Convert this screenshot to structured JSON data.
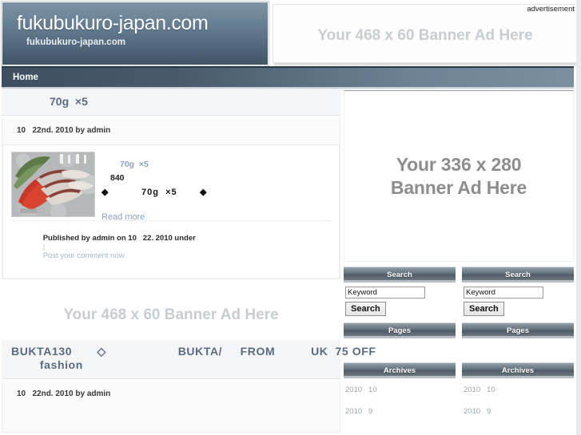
{
  "site": {
    "title": "fukubukuro-japan.com",
    "tagline": "fukubukuro-japan.com"
  },
  "nav": {
    "items": [
      {
        "label": "Home"
      }
    ]
  },
  "ads": {
    "label": "advertisement",
    "top_banner_text": "Your 468 x 60 Banner Ad Here",
    "mid_banner_text": "Your 468 x 60 Banner Ad Here",
    "sidebar_banner_text": "Your 336 x 280\nBanner Ad Here"
  },
  "posts": [
    {
      "title": "70g  ×5",
      "date_line": "10   22nd. 2010 by admin",
      "body_line_1": "70g  ×5",
      "body_line_2": "840",
      "body_line_3": "◆          70g  ×5       ◆",
      "read_more": "Read more",
      "meta_prefix": "Published by admin on 10   22. 2010 under",
      "meta_sep": "|",
      "meta_comment_link": "Post your comment now",
      "thumb_alt": "salmon-sashimi-photo"
    },
    {
      "title": "BUKTA130       ◇                    BUKTA/     FROM          UK  75 OFF\n        fashion",
      "date_line": "10   22nd. 2010 by admin"
    }
  ],
  "sidebar": {
    "columns": [
      {
        "search": {
          "heading": "Search",
          "input_value": "Keyword",
          "input_placeholder": "Keyword",
          "button_label": "Search"
        },
        "pages": {
          "heading": "Pages"
        },
        "archives": {
          "heading": "Archives",
          "items": [
            "2010   10",
            "2010   9"
          ]
        }
      },
      {
        "search": {
          "heading": "Search",
          "input_value": "Keyword",
          "input_placeholder": "Keyword",
          "button_label": "Search"
        },
        "pages": {
          "heading": "Pages"
        },
        "archives": {
          "heading": "Archives",
          "items": [
            "2010   10",
            "2010   9"
          ]
        }
      }
    ]
  },
  "colors": {
    "header_top": "#7d93a6",
    "header_bottom": "#415468",
    "nav_dark": "#3d4f60",
    "nav_light": "#7c8f9f",
    "link_blue": "#8ba2bb",
    "title_blue": "#5a6b80",
    "ad_text_gray": "#c9cdd2"
  }
}
